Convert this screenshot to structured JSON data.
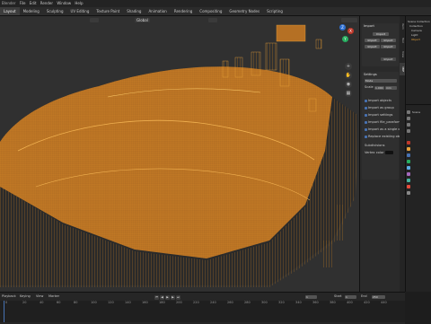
{
  "app_title": "Blender",
  "top_menu": [
    "File",
    "Edit",
    "Render",
    "Window",
    "Help"
  ],
  "workspace_tabs": [
    "Layout",
    "Modeling",
    "Sculpting",
    "UV Editing",
    "Texture Paint",
    "Shading",
    "Animation",
    "Rendering",
    "Compositing",
    "Geometry Nodes",
    "Scripting"
  ],
  "active_tab": "Layout",
  "viewport": {
    "orientation_label": "Global",
    "gizmo": {
      "x": "X",
      "y": "Y",
      "z": "Z"
    }
  },
  "npanel": {
    "tabs": [
      "Item",
      "Tool",
      "View",
      "3MF"
    ],
    "import_section": {
      "title": "Import",
      "buttons": [
        "Import",
        "Import",
        "Import",
        "Import",
        "Import",
        "Import"
      ]
    },
    "settings_section": {
      "title": "Settings",
      "mode_value": "Mode",
      "scale_label": "Scale",
      "scale_value": "1.000",
      "unit_value": "mm",
      "rows": [
        "Import objects",
        "Import as group",
        "Import settings",
        "Import file_paraforms",
        "Import as a single object",
        "Replace existing object"
      ],
      "field_label": "Subdivisions",
      "color_label": "Vertex color"
    }
  },
  "outliner": {
    "items": [
      "Scene Collection",
      "Collection",
      "Camera",
      "Light",
      "Object"
    ]
  },
  "properties": {
    "labels": [
      "Scene",
      "Render",
      "Output",
      "View Layer",
      "World",
      "Object",
      "Modifiers",
      "Particles",
      "Physics",
      "Constraints",
      "Data",
      "Material",
      "Texture"
    ]
  },
  "timeline": {
    "playback_label": "Playback",
    "keying_label": "Keying",
    "view_label": "View",
    "marker_label": "Marker",
    "current_frame": "1",
    "start_label": "Start",
    "start_value": "1",
    "end_label": "End",
    "end_value": "250",
    "ruler": [
      "0",
      "20",
      "40",
      "60",
      "80",
      "100",
      "120",
      "140",
      "160",
      "180",
      "200",
      "220",
      "240",
      "260",
      "280",
      "300",
      "320",
      "340",
      "360",
      "380",
      "400",
      "420",
      "440"
    ]
  },
  "colors": {
    "mesh": "#e8a23a",
    "accent": "#4772b3",
    "viewport_bg": "#303030"
  }
}
